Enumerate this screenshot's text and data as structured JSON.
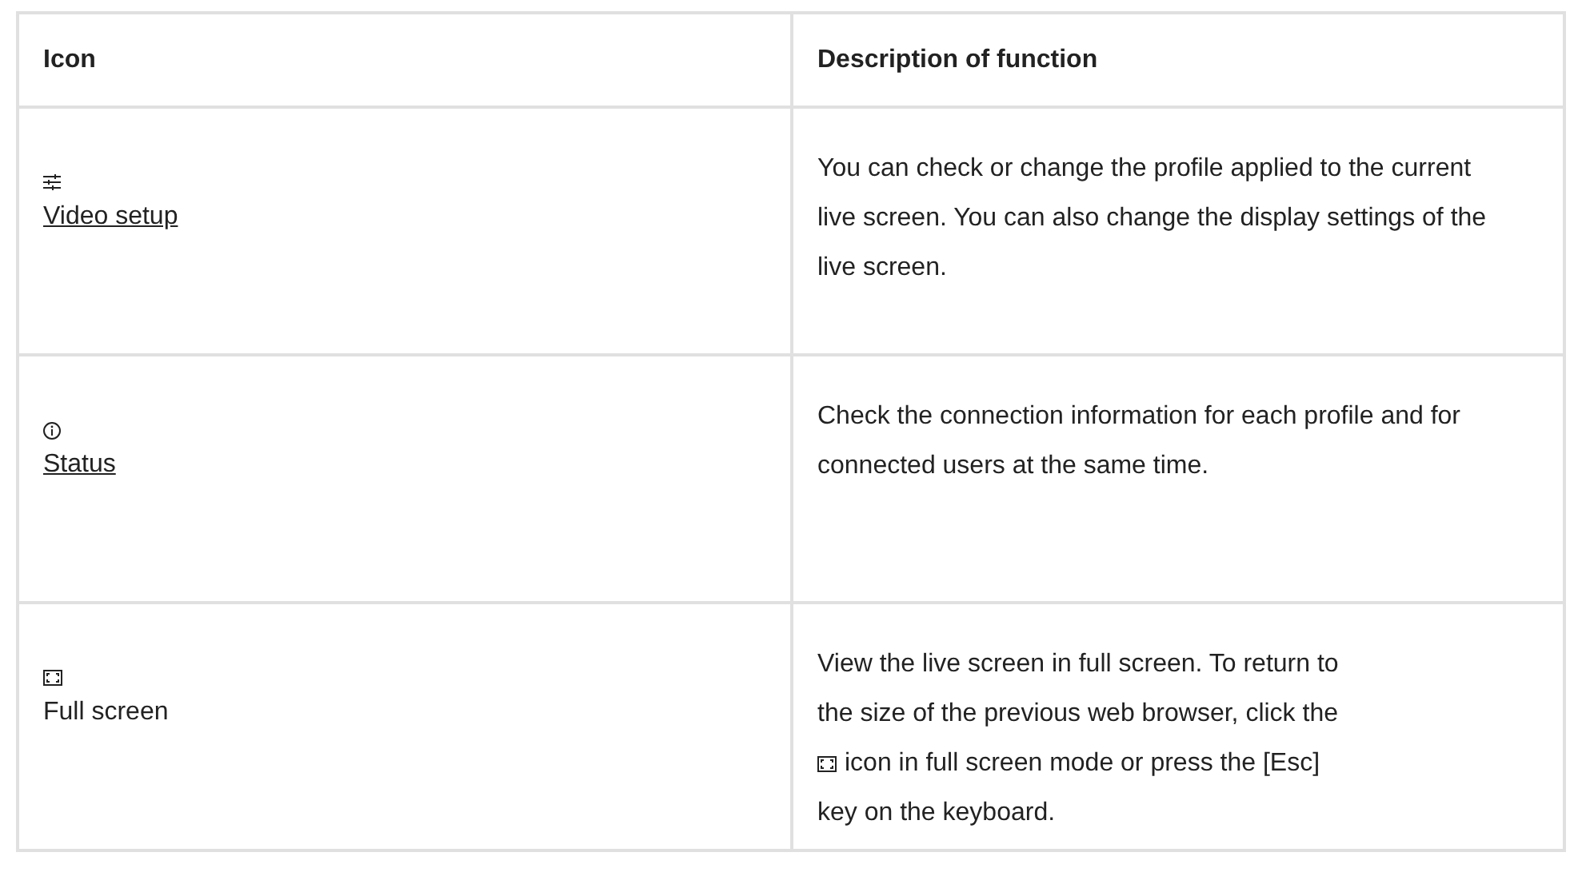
{
  "table": {
    "columns": [
      "Icon",
      "Description of function"
    ],
    "rows": [
      {
        "label": "Video setup",
        "link": true,
        "description": [
          {
            "kind": "text",
            "text": "You can check or change the profile applied to the current live screen. You can also change the display settings of the live screen."
          }
        ]
      },
      {
        "label": "Status",
        "link": true,
        "description": [
          {
            "kind": "text",
            "text": "Check the connection information for each profile and for connected users at the same time."
          }
        ]
      },
      {
        "label": "Full screen",
        "link": false,
        "description": [
          {
            "kind": "text",
            "text": "View the live screen in full screen. To return to"
          },
          {
            "kind": "text",
            "text": "the size of the previous web browser, click the"
          },
          {
            "kind": "icon_text",
            "text": "icon in full screen mode or press the [Esc]"
          },
          {
            "kind": "text",
            "text": "key on the keyboard."
          }
        ]
      }
    ]
  }
}
